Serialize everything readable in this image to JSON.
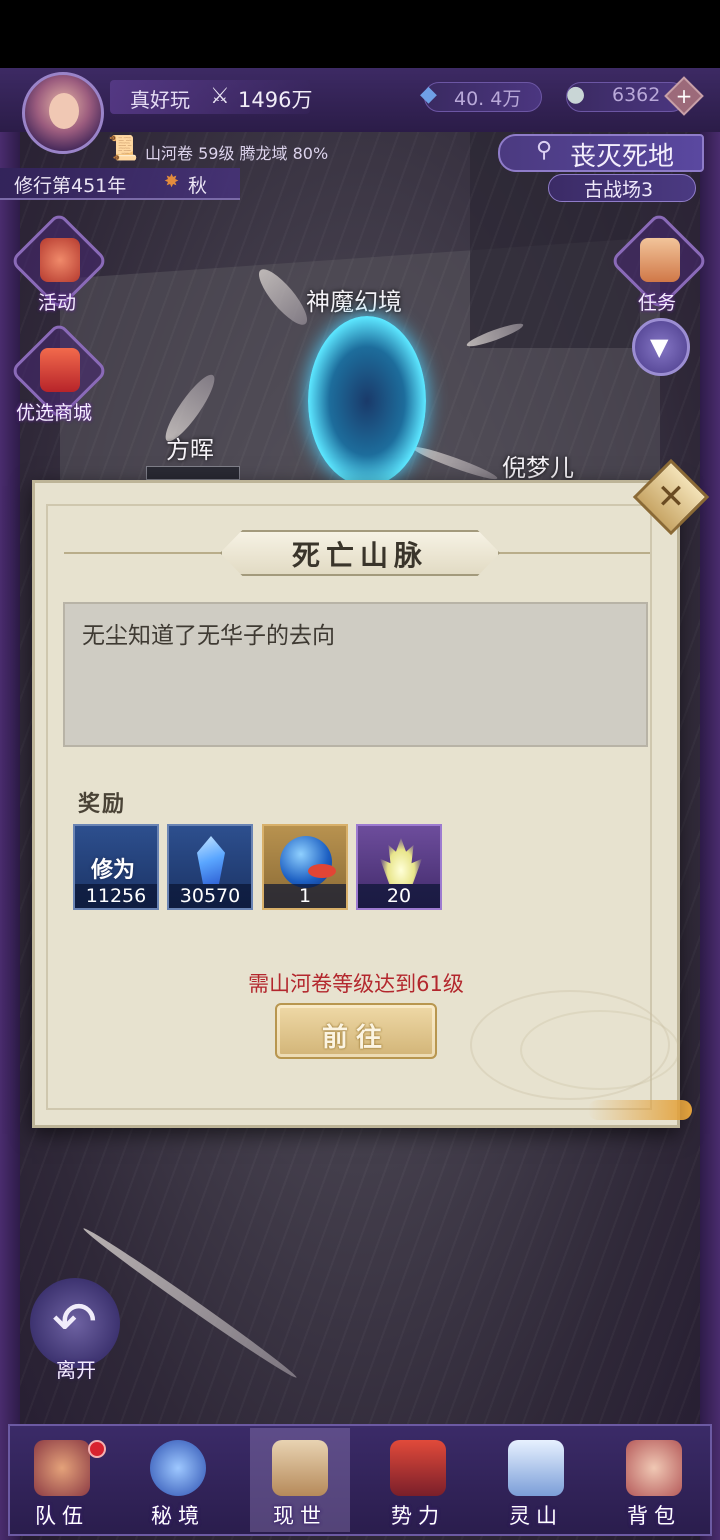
{
  "player": {
    "name": "真好玩",
    "power": "1496万"
  },
  "resources": {
    "spirit_stones": "40. 4万",
    "jade": "6362",
    "add_symbol": "+"
  },
  "player_subinfo": "山河卷 59级 腾龙域 80%",
  "era": {
    "label": "修行第451年",
    "season": "秋"
  },
  "location": {
    "main": "丧灭死地",
    "sub": "古战场3"
  },
  "side_buttons": {
    "activity": "活动",
    "shop": "优选商城",
    "task": "任务"
  },
  "map_labels": {
    "portal": "神魔幻境",
    "npc_left": "方晖",
    "npc_right": "倪梦儿"
  },
  "dialog": {
    "title": "死亡山脉",
    "description": "无尘知道了无华子的去向",
    "reward_label": "奖励",
    "rewards": [
      {
        "name": "修为",
        "count": "11256"
      },
      {
        "name": "灵石",
        "count": "30570"
      },
      {
        "name": "宝珠",
        "count": "1"
      },
      {
        "name": "灵火",
        "count": "20"
      }
    ],
    "requirement": "需山河卷等级达到61级",
    "go_button": "前往",
    "close_symbol": "✕"
  },
  "leave_button": "离开",
  "bottom_nav": [
    {
      "label": "队伍",
      "active": false
    },
    {
      "label": "秘境",
      "active": false
    },
    {
      "label": "现世",
      "active": true
    },
    {
      "label": "势力",
      "active": false
    },
    {
      "label": "灵山",
      "active": false
    },
    {
      "label": "背包",
      "active": false
    }
  ],
  "colors": {
    "accent_purple": "#3d2a64",
    "dialog_bg": "#e7e2cf",
    "requirement_red": "#b3272d",
    "button_gold": "#d2b477"
  },
  "icons": [
    "power-icon",
    "spirit-stone-icon",
    "jade-icon",
    "plus-icon",
    "book-icon",
    "maple-leaf-icon",
    "location-icon",
    "close-icon",
    "leave-arrow-icon"
  ]
}
